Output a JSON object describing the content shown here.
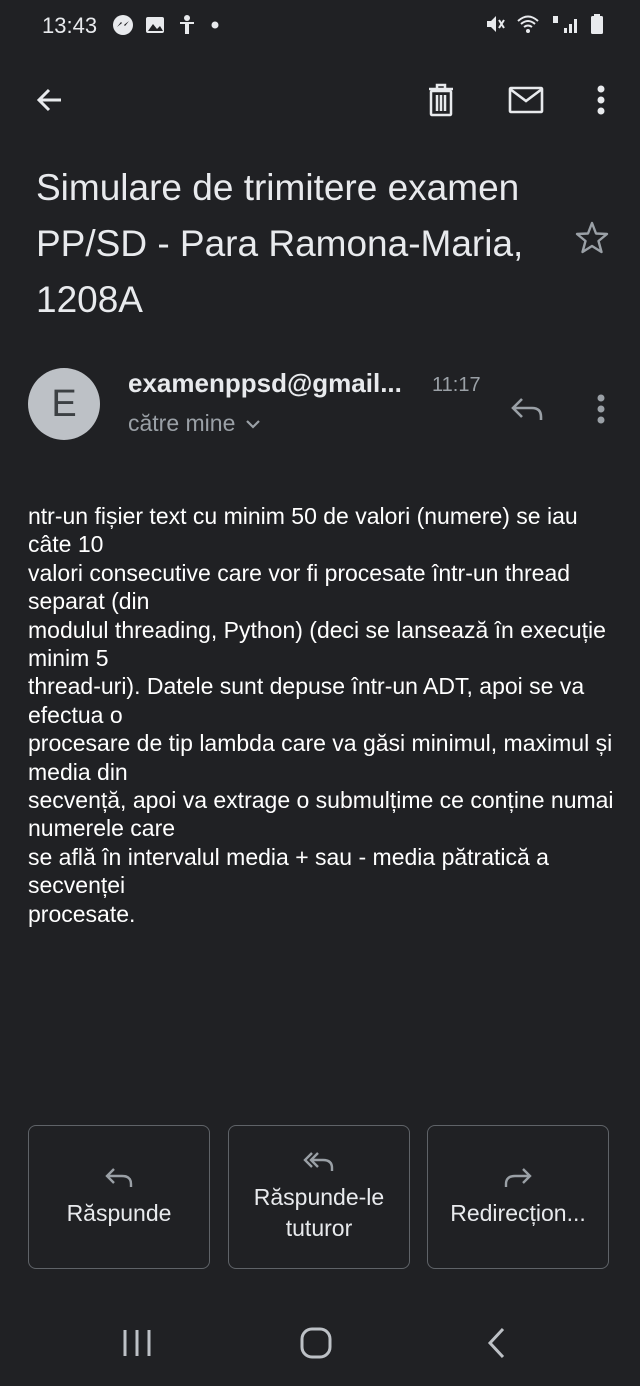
{
  "status_bar": {
    "time": "13:43"
  },
  "toolbar": {
    "back_icon": "arrow-back",
    "delete_icon": "trash",
    "mark_unread_icon": "mail",
    "more_icon": "more-vertical"
  },
  "email": {
    "subject": "Simulare de trimitere examen PP/SD - Para Ramona-Maria, 1208A",
    "sender_initial": "E",
    "sender": "examenppsd@gmail...",
    "time": "11:17",
    "recipient": "către mine",
    "body_lines": [
      "ntr-un fișier text cu minim 50 de valori (numere) se iau câte 10",
      "valori consecutive care vor fi procesate într-un thread separat (din",
      "modulul threading, Python) (deci se lansează în execuție minim 5",
      "thread-uri). Datele sunt depuse într-un ADT, apoi se va efectua o",
      "procesare de tip lambda care va găsi minimul, maximul și media din",
      "secvență, apoi va extrage o submulțime ce conține numai numerele care",
      "se află în intervalul media + sau - media pătratică a secvenței",
      "procesate."
    ]
  },
  "actions": {
    "reply": "Răspunde",
    "reply_all": "Răspunde-le tuturor",
    "forward": "Redirecțion..."
  },
  "colors": {
    "background": "#202124",
    "text": "#e8eaed",
    "secondary": "#9aa0a6",
    "border": "#5f6368"
  }
}
